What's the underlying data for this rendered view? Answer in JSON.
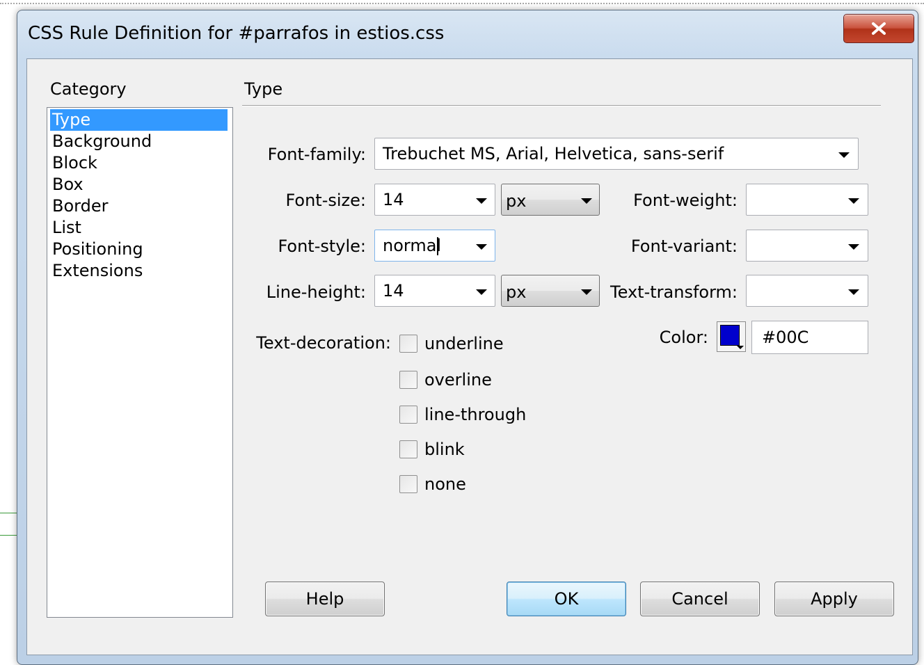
{
  "window": {
    "title": "CSS Rule Definition for #parrafos in estios.css",
    "close_label": "x"
  },
  "category": {
    "header": "Category",
    "items": [
      "Type",
      "Background",
      "Block",
      "Box",
      "Border",
      "List",
      "Positioning",
      "Extensions"
    ],
    "selected": "Type"
  },
  "section": {
    "header": "Type"
  },
  "fields": {
    "font_family": {
      "label": "Font-family:",
      "value": "Trebuchet MS, Arial, Helvetica, sans-serif"
    },
    "font_size": {
      "label": "Font-size:",
      "value": "14",
      "unit": "px"
    },
    "font_weight": {
      "label": "Font-weight:",
      "value": ""
    },
    "font_style": {
      "label": "Font-style:",
      "value": "normal"
    },
    "font_variant": {
      "label": "Font-variant:",
      "value": ""
    },
    "line_height": {
      "label": "Line-height:",
      "value": "14",
      "unit": "px"
    },
    "text_transform": {
      "label": "Text-transform:",
      "value": ""
    },
    "color": {
      "label": "Color:",
      "value": "#00C",
      "swatch": "#0000cc"
    }
  },
  "text_decoration": {
    "label": "Text-decoration:",
    "options": [
      {
        "label": "underline",
        "checked": false
      },
      {
        "label": "overline",
        "checked": false
      },
      {
        "label": "line-through",
        "checked": false
      },
      {
        "label": "blink",
        "checked": false
      },
      {
        "label": "none",
        "checked": false
      }
    ]
  },
  "buttons": {
    "help": "Help",
    "ok": "OK",
    "cancel": "Cancel",
    "apply": "Apply"
  },
  "icons": [
    "close-icon",
    "dropdown-arrow-icon",
    "color-swatch-icon"
  ]
}
